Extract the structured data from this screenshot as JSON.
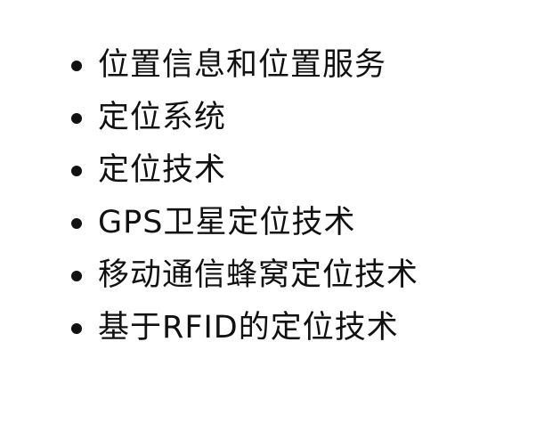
{
  "bullets": [
    "位置信息和位置服务",
    "定位系统",
    "定位技术",
    "GPS卫星定位技术",
    "移动通信蜂窝定位技术",
    "基于RFID的定位技术"
  ]
}
